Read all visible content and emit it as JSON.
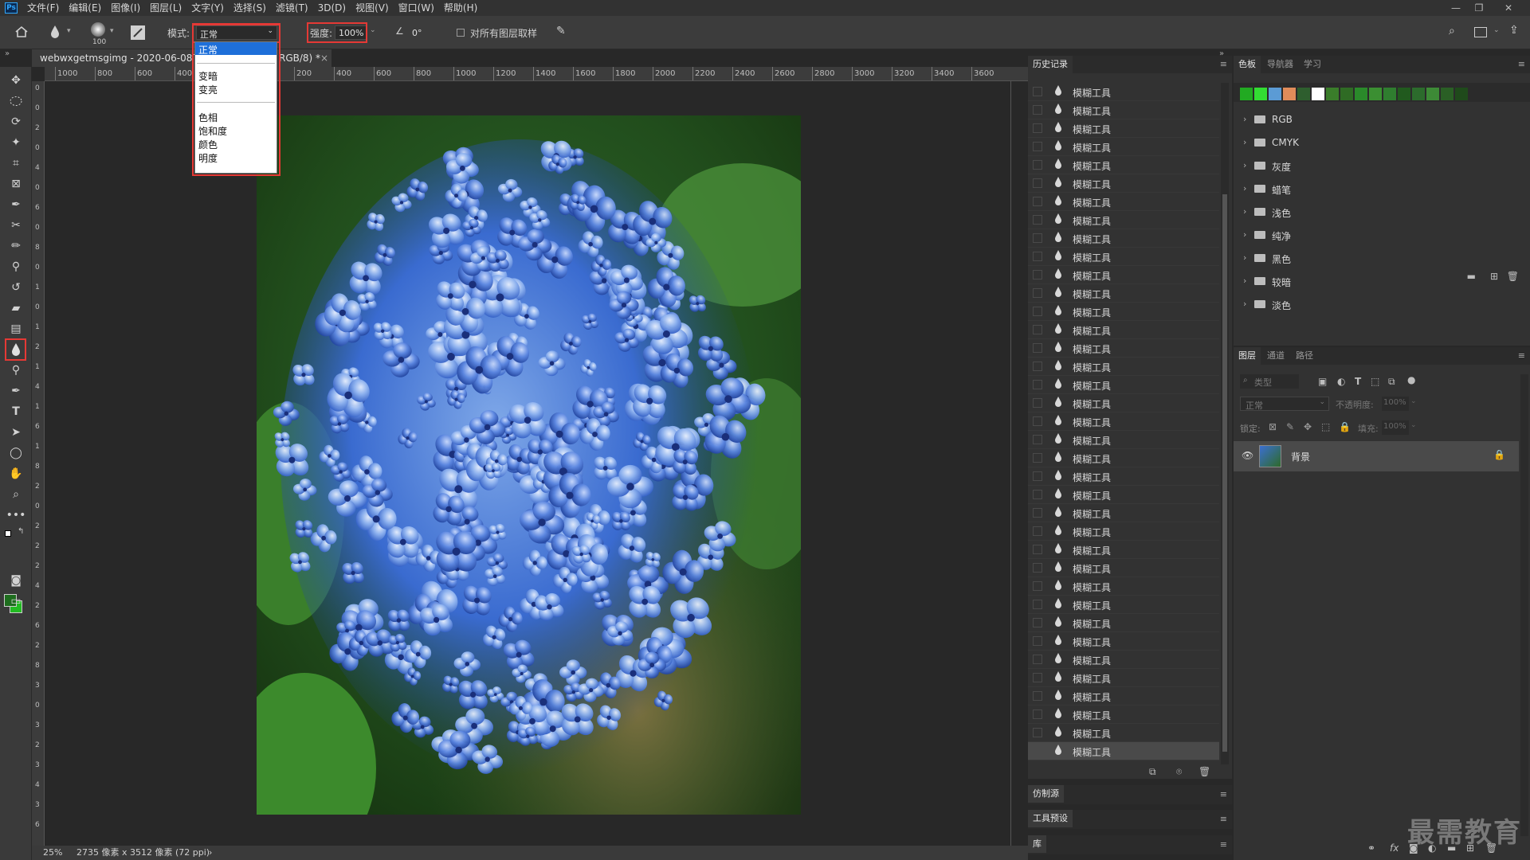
{
  "menubar": {
    "logo": "Ps",
    "items": [
      "文件(F)",
      "编辑(E)",
      "图像(I)",
      "图层(L)",
      "文字(Y)",
      "选择(S)",
      "滤镜(T)",
      "3D(D)",
      "视图(V)",
      "窗口(W)",
      "帮助(H)"
    ],
    "window_controls": [
      "—",
      "❐",
      "✕"
    ]
  },
  "options_bar": {
    "brush_size": "100",
    "mode_label": "模式:",
    "mode_value": "正常",
    "strength_label": "强度:",
    "strength_value": "100%",
    "angle_value": "0°",
    "sample_all_layers_label": "对所有图层取样"
  },
  "mode_dropdown": {
    "selected": "正常",
    "groups": [
      [
        "正常"
      ],
      [
        "变暗",
        "变亮"
      ],
      [
        "色相",
        "饱和度",
        "颜色",
        "明度"
      ]
    ]
  },
  "document": {
    "tab_title": "webwxgetmsgimg - 2020-06-08T11",
    "tab_suffix": "RGB/8) *",
    "tab_close": "×",
    "zoom": "25%",
    "info": "2735 像素 x 3512 像素 (72 ppi)",
    "info_arrow": "›"
  },
  "ruler": {
    "top_ticks": [
      "1000",
      "800",
      "600",
      "400",
      "200",
      "0",
      "200",
      "400",
      "600",
      "800",
      "1000",
      "1200",
      "1400",
      "1600",
      "1800",
      "2000",
      "2200",
      "2400",
      "2600",
      "2800",
      "3000",
      "3200",
      "3400",
      "3600"
    ],
    "left_ticks": [
      "0",
      "0",
      "2",
      "0",
      "4",
      "0",
      "6",
      "0",
      "8",
      "0",
      "1",
      "0",
      "1",
      "2",
      "1",
      "4",
      "1",
      "6",
      "1",
      "8",
      "2",
      "0",
      "2",
      "2",
      "2",
      "4",
      "2",
      "6",
      "2",
      "8",
      "3",
      "0",
      "3",
      "2",
      "3",
      "4",
      "3",
      "6"
    ]
  },
  "history_panel": {
    "title": "历史记录",
    "items": [
      "模糊工具",
      "模糊工具",
      "模糊工具",
      "模糊工具",
      "模糊工具",
      "模糊工具",
      "模糊工具",
      "模糊工具",
      "模糊工具",
      "模糊工具",
      "模糊工具",
      "模糊工具",
      "模糊工具",
      "模糊工具",
      "模糊工具",
      "模糊工具",
      "模糊工具",
      "模糊工具",
      "模糊工具",
      "模糊工具",
      "模糊工具",
      "模糊工具",
      "模糊工具",
      "模糊工具",
      "模糊工具",
      "模糊工具",
      "模糊工具",
      "模糊工具",
      "模糊工具",
      "模糊工具",
      "模糊工具",
      "模糊工具",
      "模糊工具",
      "模糊工具",
      "模糊工具",
      "模糊工具",
      "模糊工具"
    ]
  },
  "collapsed_panels": [
    "仿制源",
    "工具预设",
    "库"
  ],
  "swatches_panel": {
    "tabs": [
      "色板",
      "导航器",
      "学习"
    ],
    "colors": [
      "#22aa22",
      "#33dd33",
      "#5b9bd5",
      "#e08c5a",
      "#2e5e2e",
      "#ffffff",
      "#3a7d2a",
      "#2f6b24",
      "#2a8a2a",
      "#3b8f32",
      "#2f7d2f",
      "#215a1e",
      "#2c6b2c",
      "#3d8a36",
      "#2a5f25",
      "#1f4a1b"
    ],
    "folders": [
      "RGB",
      "CMYK",
      "灰度",
      "蜡笔",
      "浅色",
      "纯净",
      "黑色",
      "较暗",
      "淡色"
    ]
  },
  "layers_panel": {
    "tabs": [
      "图层",
      "通道",
      "路径"
    ],
    "search_placeholder": "类型",
    "blend_mode": "正常",
    "opacity_label": "不透明度:",
    "opacity_value": "100%",
    "lock_label": "锁定:",
    "fill_label": "填充:",
    "fill_value": "100%",
    "layers": [
      {
        "name": "背景"
      }
    ]
  },
  "watermark": "最需教育"
}
